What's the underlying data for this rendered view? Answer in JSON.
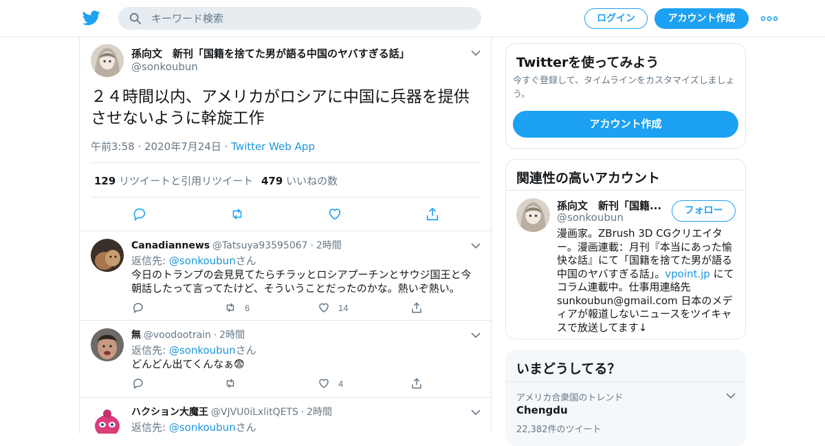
{
  "colors": {
    "accent": "#1da1f2",
    "link": "#1b95e0",
    "text": "#14171a",
    "muted": "#657786",
    "border": "#e1e8ed"
  },
  "header": {
    "search_placeholder": "キーワード検索",
    "login_label": "ログイン",
    "signup_label": "アカウント作成"
  },
  "main_tweet": {
    "name": "孫向文　新刊「国籍を捨てた男が語る中国のヤバすぎる話」",
    "handle": "@sonkoubun",
    "text": "２４時間以内、アメリカがロシアに中国に兵器を提供させないように幹旋工作",
    "time": "午前3:58",
    "date": "2020年7月24日",
    "via": "Twitter Web App",
    "retweets_count": "129",
    "retweets_label": "リツイートと引用リツイート",
    "likes_count": "479",
    "likes_label": "いいねの数"
  },
  "replies": [
    {
      "name": "Canadiannews",
      "handle": "@Tatsuya93595067",
      "time": "2時間",
      "reply_to_prefix": "返信先: ",
      "reply_to_handle": "@sonkoubun",
      "reply_to_suffix": "さん",
      "text": "今日のトランプの会見見てたらチラッとロシアプーチンとサウジ国王と今朝話したって言ってたけど、そういうことだったのかな。熱いぞ熱い。",
      "retweets": "6",
      "likes": "14"
    },
    {
      "name": "無",
      "handle": "@voodootrain",
      "time": "2時間",
      "reply_to_prefix": "返信先: ",
      "reply_to_handle": "@sonkoubun",
      "reply_to_suffix": "さん",
      "text": "どんどん出てくんなぁ😨",
      "retweets": "",
      "likes": "4"
    },
    {
      "name": "ハクション大魔王",
      "handle": "@VJVU0iLxlitQETS",
      "time": "2時間",
      "reply_to_prefix": "返信先: ",
      "reply_to_handle": "@sonkoubun",
      "reply_to_suffix": "さん"
    }
  ],
  "signup_card": {
    "title": "Twitterを使ってみよう",
    "subtitle": "今すぐ登録して、タイムラインをカスタマイズしましょう。",
    "button_label": "アカウント作成"
  },
  "related_card": {
    "title": "関連性の高いアカウント",
    "name": "孫向文　新刊「国籍...",
    "handle": "@sonkoubun",
    "follow_label": "フォロー",
    "bio_before": "漫画家。ZBrush 3D CGクリエイター。漫画連載：月刊『本当にあった愉快な話』にて「国籍を捨てた男が語る中国のヤバすぎる話」。",
    "bio_link": "vpoint.jp",
    "bio_after": " にてコラム連載中。仕事用連絡先 sunkoubun@gmail.com 日本のメディアが報道しないニュースをツイキャスで放送してます↓"
  },
  "trends_card": {
    "title": "いまどうしてる？",
    "context": "アメリカ合衆国のトレンド",
    "trend_name": "Chengdu",
    "tweet_count": "22,382件のツイート"
  }
}
